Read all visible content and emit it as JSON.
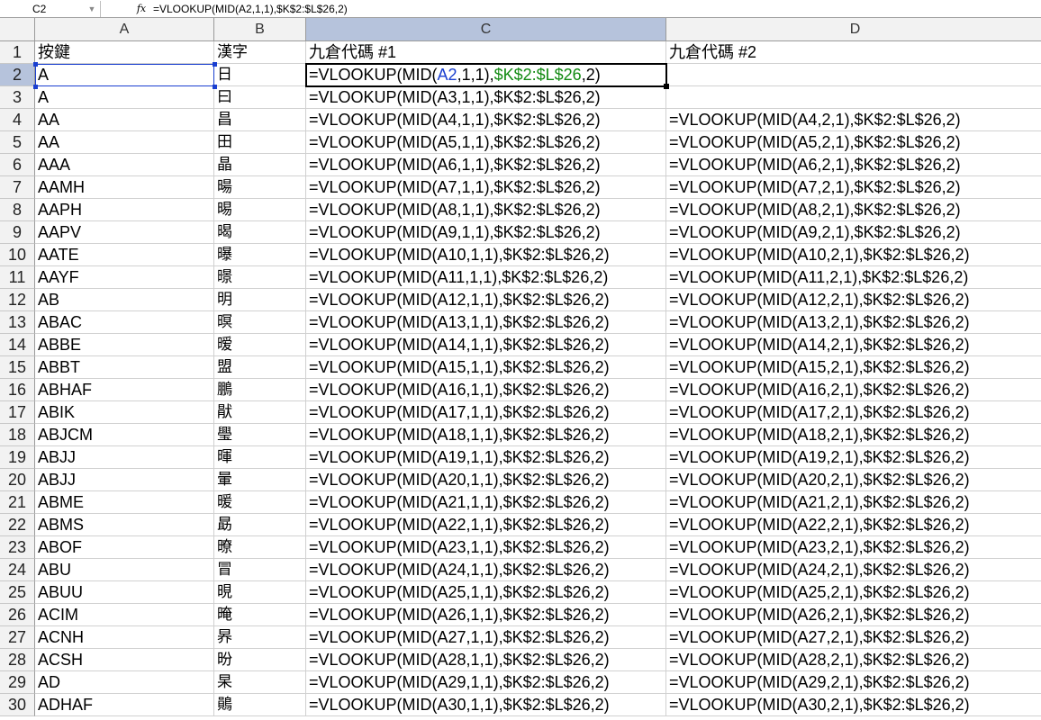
{
  "formula_bar": {
    "name_box": "C2",
    "fx_icon": "fx",
    "formula": "=VLOOKUP(MID(A2,1,1),$K$2:$L$26,2)"
  },
  "columns": [
    "A",
    "B",
    "C",
    "D"
  ],
  "row_numbers": [
    "1",
    "2",
    "3",
    "4",
    "5",
    "6",
    "7",
    "8",
    "9",
    "10",
    "11",
    "12",
    "13",
    "14",
    "15",
    "16",
    "17",
    "18",
    "19",
    "20",
    "21",
    "22",
    "23",
    "24",
    "25",
    "26",
    "27",
    "28",
    "29",
    "30"
  ],
  "active_cell": "C2",
  "active_cell_edit": {
    "prefix": "=VLOOKUP(MID(",
    "ref1": "A2",
    "mid": ",1,1),",
    "ref2": "$K$2:$L$26",
    "suffix": ",2)"
  },
  "rows": [
    {
      "a": "按鍵",
      "b": "漢字",
      "c": "九倉代碼 #1",
      "d": "九倉代碼 #2"
    },
    {
      "a": "A",
      "b": "日",
      "c": "",
      "d": ""
    },
    {
      "a": "A",
      "b": "曰",
      "c": "=VLOOKUP(MID(A3,1,1),$K$2:$L$26,2)",
      "d": ""
    },
    {
      "a": "AA",
      "b": "昌",
      "c": "=VLOOKUP(MID(A4,1,1),$K$2:$L$26,2)",
      "d": "=VLOOKUP(MID(A4,2,1),$K$2:$L$26,2)"
    },
    {
      "a": "AA",
      "b": "田",
      "c": "=VLOOKUP(MID(A5,1,1),$K$2:$L$26,2)",
      "d": "=VLOOKUP(MID(A5,2,1),$K$2:$L$26,2)"
    },
    {
      "a": "AAA",
      "b": "晶",
      "c": "=VLOOKUP(MID(A6,1,1),$K$2:$L$26,2)",
      "d": "=VLOOKUP(MID(A6,2,1),$K$2:$L$26,2)"
    },
    {
      "a": "AAMH",
      "b": "暘",
      "c": "=VLOOKUP(MID(A7,1,1),$K$2:$L$26,2)",
      "d": "=VLOOKUP(MID(A7,2,1),$K$2:$L$26,2)"
    },
    {
      "a": "AAPH",
      "b": "晹",
      "c": "=VLOOKUP(MID(A8,1,1),$K$2:$L$26,2)",
      "d": "=VLOOKUP(MID(A8,2,1),$K$2:$L$26,2)"
    },
    {
      "a": "AAPV",
      "b": "暍",
      "c": "=VLOOKUP(MID(A9,1,1),$K$2:$L$26,2)",
      "d": "=VLOOKUP(MID(A9,2,1),$K$2:$L$26,2)"
    },
    {
      "a": "AATE",
      "b": "曝",
      "c": "=VLOOKUP(MID(A10,1,1),$K$2:$L$26,2)",
      "d": "=VLOOKUP(MID(A10,2,1),$K$2:$L$26,2)"
    },
    {
      "a": "AAYF",
      "b": "暻",
      "c": "=VLOOKUP(MID(A11,1,1),$K$2:$L$26,2)",
      "d": "=VLOOKUP(MID(A11,2,1),$K$2:$L$26,2)"
    },
    {
      "a": "AB",
      "b": "明",
      "c": "=VLOOKUP(MID(A12,1,1),$K$2:$L$26,2)",
      "d": "=VLOOKUP(MID(A12,2,1),$K$2:$L$26,2)"
    },
    {
      "a": "ABAC",
      "b": "暝",
      "c": "=VLOOKUP(MID(A13,1,1),$K$2:$L$26,2)",
      "d": "=VLOOKUP(MID(A13,2,1),$K$2:$L$26,2)"
    },
    {
      "a": "ABBE",
      "b": "暧",
      "c": "=VLOOKUP(MID(A14,1,1),$K$2:$L$26,2)",
      "d": "=VLOOKUP(MID(A14,2,1),$K$2:$L$26,2)"
    },
    {
      "a": "ABBT",
      "b": "盟",
      "c": "=VLOOKUP(MID(A15,1,1),$K$2:$L$26,2)",
      "d": "=VLOOKUP(MID(A15,2,1),$K$2:$L$26,2)"
    },
    {
      "a": "ABHAF",
      "b": "鵬",
      "c": "=VLOOKUP(MID(A16,1,1),$K$2:$L$26,2)",
      "d": "=VLOOKUP(MID(A16,2,1),$K$2:$L$26,2)"
    },
    {
      "a": "ABIK",
      "b": "猒",
      "c": "=VLOOKUP(MID(A17,1,1),$K$2:$L$26,2)",
      "d": "=VLOOKUP(MID(A17,2,1),$K$2:$L$26,2)"
    },
    {
      "a": "ABJCM",
      "b": "璺",
      "c": "=VLOOKUP(MID(A18,1,1),$K$2:$L$26,2)",
      "d": "=VLOOKUP(MID(A18,2,1),$K$2:$L$26,2)"
    },
    {
      "a": "ABJJ",
      "b": "暉",
      "c": "=VLOOKUP(MID(A19,1,1),$K$2:$L$26,2)",
      "d": "=VLOOKUP(MID(A19,2,1),$K$2:$L$26,2)"
    },
    {
      "a": "ABJJ",
      "b": "暈",
      "c": "=VLOOKUP(MID(A20,1,1),$K$2:$L$26,2)",
      "d": "=VLOOKUP(MID(A20,2,1),$K$2:$L$26,2)"
    },
    {
      "a": "ABME",
      "b": "暖",
      "c": "=VLOOKUP(MID(A21,1,1),$K$2:$L$26,2)",
      "d": "=VLOOKUP(MID(A21,2,1),$K$2:$L$26,2)"
    },
    {
      "a": "ABMS",
      "b": "勗",
      "c": "=VLOOKUP(MID(A22,1,1),$K$2:$L$26,2)",
      "d": "=VLOOKUP(MID(A22,2,1),$K$2:$L$26,2)"
    },
    {
      "a": "ABOF",
      "b": "暸",
      "c": "=VLOOKUP(MID(A23,1,1),$K$2:$L$26,2)",
      "d": "=VLOOKUP(MID(A23,2,1),$K$2:$L$26,2)"
    },
    {
      "a": "ABU",
      "b": "冒",
      "c": "=VLOOKUP(MID(A24,1,1),$K$2:$L$26,2)",
      "d": "=VLOOKUP(MID(A24,2,1),$K$2:$L$26,2)"
    },
    {
      "a": "ABUU",
      "b": "晛",
      "c": "=VLOOKUP(MID(A25,1,1),$K$2:$L$26,2)",
      "d": "=VLOOKUP(MID(A25,2,1),$K$2:$L$26,2)"
    },
    {
      "a": "ACIM",
      "b": "晻",
      "c": "=VLOOKUP(MID(A26,1,1),$K$2:$L$26,2)",
      "d": "=VLOOKUP(MID(A26,2,1),$K$2:$L$26,2)"
    },
    {
      "a": "ACNH",
      "b": "昦",
      "c": "=VLOOKUP(MID(A27,1,1),$K$2:$L$26,2)",
      "d": "=VLOOKUP(MID(A27,2,1),$K$2:$L$26,2)"
    },
    {
      "a": "ACSH",
      "b": "昐",
      "c": "=VLOOKUP(MID(A28,1,1),$K$2:$L$26,2)",
      "d": "=VLOOKUP(MID(A28,2,1),$K$2:$L$26,2)"
    },
    {
      "a": "AD",
      "b": "杲",
      "c": "=VLOOKUP(MID(A29,1,1),$K$2:$L$26,2)",
      "d": "=VLOOKUP(MID(A29,2,1),$K$2:$L$26,2)"
    },
    {
      "a": "ADHAF",
      "b": "鶰",
      "c": "=VLOOKUP(MID(A30,1,1),$K$2:$L$26,2)",
      "d": "=VLOOKUP(MID(A30,2,1),$K$2:$L$26,2)"
    }
  ],
  "colors": {
    "selected_header": "#b6c3dc",
    "reference_blue": "#1a3fd0",
    "reference_green": "#118a11"
  }
}
